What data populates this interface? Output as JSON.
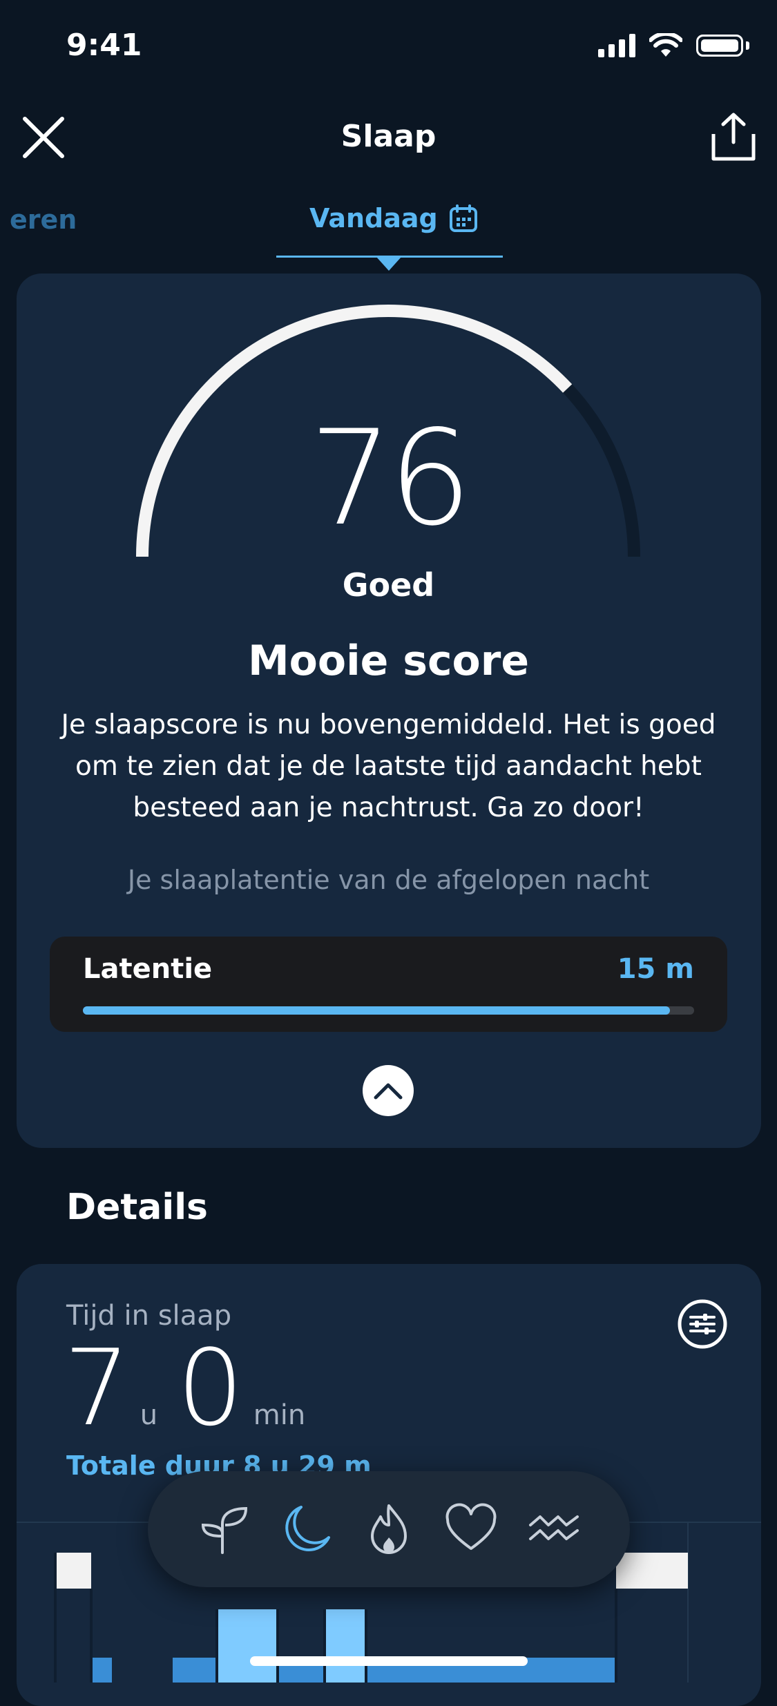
{
  "status_bar": {
    "time": "9:41"
  },
  "header": {
    "title": "Slaap"
  },
  "tabs": [
    {
      "label": "eren"
    },
    {
      "label": "Vandaag"
    }
  ],
  "score_card": {
    "score": "76",
    "score_fraction": 0.76,
    "rating": "Goed",
    "headline": "Mooie score",
    "body": "Je slaapscore is nu bovengemiddeld. Het is goed om te zien dat je de laatste tijd aandacht hebt besteed aan je nachtrust. Ga zo door!",
    "subtext": "Je slaaplatentie van de afgelopen nacht",
    "latency": {
      "label": "Latentie",
      "value": "15 m",
      "fill_percent": 96
    }
  },
  "details": {
    "heading": "Details",
    "sleep_time": {
      "label": "Tijd in slaap",
      "hours": "7",
      "hours_unit": "u",
      "minutes": "0",
      "minutes_unit": "min",
      "total": "Totale duur 8 u 29 m"
    }
  },
  "colors": {
    "background": "#0b1623",
    "card": "#16283e",
    "accent": "#5ab7f2",
    "hypnogram_light": "#7fcbff",
    "hypnogram_deep": "#3a8ed6"
  },
  "bottom_nav": {
    "items": [
      {
        "icon": "sprout-icon"
      },
      {
        "icon": "moon-icon",
        "active": true
      },
      {
        "icon": "flame-icon"
      },
      {
        "icon": "heart-icon"
      },
      {
        "icon": "waves-icon"
      }
    ]
  }
}
